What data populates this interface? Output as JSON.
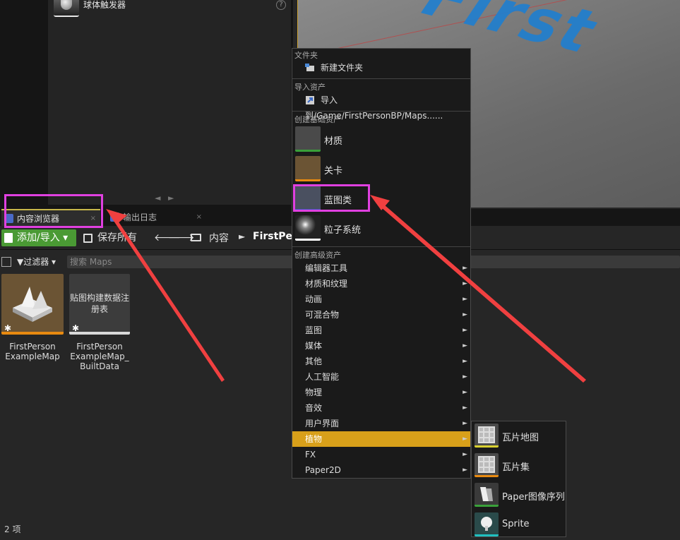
{
  "top_panel": {
    "sphere_trigger_label": "球体触发器",
    "help_icon": "?",
    "scroll_left_glyph": "◄",
    "scroll_right_glyph": "►"
  },
  "viewport": {
    "overlay_text": "First"
  },
  "tabs": [
    {
      "label": "内容浏览器",
      "close": "×"
    },
    {
      "label": "输出日志",
      "close": "×"
    }
  ],
  "toolbar": {
    "add_import_label": "添加/导入 ▾",
    "save_all_label": "保存所有",
    "back_glyph": "🡐",
    "forward_glyph": "🡒",
    "breadcrumb": [
      "内容",
      "FirstPer"
    ],
    "breadcrumb_sep": "►"
  },
  "filter": {
    "filter_label": "▼过滤器 ▾",
    "search_placeholder": "搜索 Maps"
  },
  "assets": [
    {
      "label": "FirstPerson ExampleMap",
      "thumb_text": "",
      "star": "✱"
    },
    {
      "label": "FirstPerson ExampleMap_ BuiltData",
      "thumb_text": "贴图构建数据注册表",
      "star": "✱"
    }
  ],
  "status": "2 项",
  "context_menu": {
    "sections": {
      "folder": "文件夹",
      "import": "导入资产",
      "basic": "创建基础资产",
      "advanced": "创建高级资产"
    },
    "new_folder": "新建文件夹",
    "import_to": "导入到/Game/FirstPersonBP/Maps......",
    "basic_assets": [
      {
        "label": "材质",
        "accent": "#3aa03a"
      },
      {
        "label": "关卡",
        "accent": "#e88a10"
      },
      {
        "label": "蓝图类",
        "accent": "#3a5ac0"
      },
      {
        "label": "粒子系统",
        "accent": "#ffffff"
      }
    ],
    "advanced_items": [
      {
        "label": "编辑器工具",
        "arrow": "►"
      },
      {
        "label": "材质和纹理",
        "arrow": "►"
      },
      {
        "label": "动画",
        "arrow": "►"
      },
      {
        "label": "可混合物",
        "arrow": "►"
      },
      {
        "label": "蓝图",
        "arrow": "►"
      },
      {
        "label": "媒体",
        "arrow": "►"
      },
      {
        "label": "其他",
        "arrow": "►"
      },
      {
        "label": "人工智能",
        "arrow": "►"
      },
      {
        "label": "物理",
        "arrow": "►"
      },
      {
        "label": "音效",
        "arrow": "►"
      },
      {
        "label": "用户界面",
        "arrow": "►"
      },
      {
        "label": "植物",
        "arrow": "►"
      },
      {
        "label": "FX",
        "arrow": "►"
      },
      {
        "label": "Paper2D",
        "arrow": "►"
      }
    ],
    "active_item": "植物"
  },
  "submenu": [
    {
      "label": "瓦片地图",
      "accent": "#d8d030"
    },
    {
      "label": "瓦片集",
      "accent": "#e88a10"
    },
    {
      "label": "Paper图像序列",
      "accent": "#3aa03a"
    },
    {
      "label": "Sprite",
      "accent": "#20c0c0"
    }
  ],
  "colors": {
    "highlight": "#e040e0",
    "arrow": "#f04040",
    "accent_active": "#d8a01a",
    "add_button": "#4a9a34"
  }
}
